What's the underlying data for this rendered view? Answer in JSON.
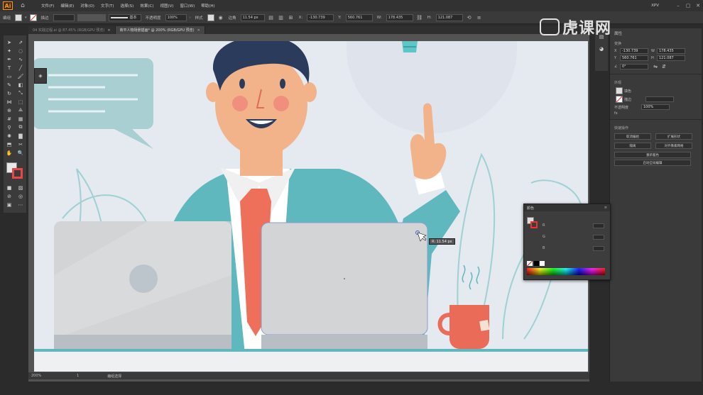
{
  "app": {
    "logo": "Ai"
  },
  "menubar": {
    "items": [
      "文件(F)",
      "编辑(E)",
      "对象(O)",
      "文字(T)",
      "选择(S)",
      "效果(C)",
      "视图(V)",
      "窗口(W)",
      "帮助(H)"
    ],
    "workspace": "XPV",
    "win_controls": [
      "–",
      "▢",
      "✕"
    ]
  },
  "controlbar": {
    "object_label": "编组",
    "stroke_label": "描边",
    "stroke_style": "基本",
    "opacity_label": "不透明度",
    "opacity_value": "100%",
    "style_label": "样式",
    "radius_label": "边角",
    "radius_value": "11.54 px",
    "x_value": "-130.739",
    "y_value": "560.761",
    "w_value": "178.435",
    "h_value": "121.087"
  },
  "tabs": [
    {
      "label": "04 实践过程.ai @ 87.45% (RGB/GPU 预览)",
      "active": false
    },
    {
      "label": "商平人物场景插画* @ 200% (RGB/GPU 预览)",
      "active": true
    }
  ],
  "status": {
    "zoom": "200%",
    "page": "1",
    "tool": "编组选择"
  },
  "tooltip": {
    "text": "R: 11.54 px"
  },
  "properties": {
    "title": "属性",
    "transform_label": "变换",
    "x": "-130.739",
    "y": "560.761",
    "w": "178.435",
    "h": "121.087",
    "angle": "0°",
    "appearance_label": "外观",
    "fill_label": "填色",
    "stroke_label": "描边",
    "opacity_label": "不透明度",
    "opacity_value": "100%",
    "fx_label": "fx",
    "quick_actions_label": "快速操作",
    "btn_ungroup": "取消编组",
    "btn_expand": "扩展形状",
    "btn_isolate": "隔离",
    "btn_recolor_art": "对齐像素网格",
    "btn_recolor": "重新着色",
    "btn_auto_layout": "启动全局编辑"
  },
  "colorpanel": {
    "title": "颜色",
    "rows": [
      "R",
      "G",
      "B"
    ]
  },
  "watermark": {
    "text": "虎课网"
  },
  "colors": {
    "bg": "#e5e9f0",
    "teal": "#5fb8bd",
    "skin": "#f2b38a",
    "hair": "#2a3b5c",
    "tie": "#ee6f5a",
    "laptop": "#d3d4d6",
    "mug": "#ea6b57"
  }
}
